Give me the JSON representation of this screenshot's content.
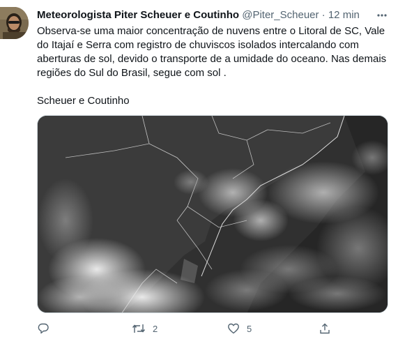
{
  "tweet": {
    "display_name": "Meteorologista Piter Scheuer e Coutinho",
    "handle": "@Piter_Scheuer",
    "separator": "·",
    "time": "12 min",
    "text": "Observa-se uma maior concentração de nuvens entre o Litoral de SC, Vale do Itajaí e Serra com registro de chuviscos isolados intercalando com aberturas de sol, devido o transporte de a umidade do oceano. Nas demais regiões do Sul do Brasil, segue com sol .",
    "signature": "Scheuer e Coutinho"
  },
  "actions": {
    "reply_count": "",
    "retweet_count": "2",
    "like_count": "5"
  },
  "icons": {
    "more": "more-icon",
    "reply": "reply-icon",
    "retweet": "retweet-icon",
    "like": "like-icon",
    "share": "share-icon"
  },
  "colors": {
    "text": "#0f1419",
    "secondary": "#536471",
    "border": "#cfd9de"
  }
}
